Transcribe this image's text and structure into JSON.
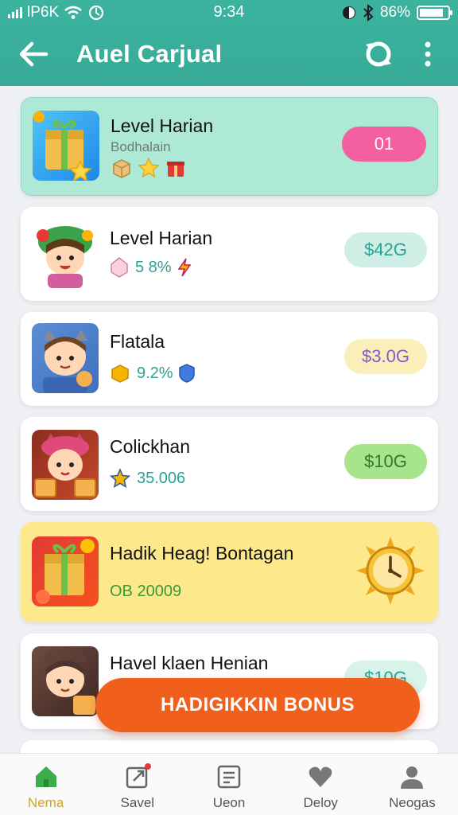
{
  "status_bar": {
    "carrier": "lP6K",
    "time": "9:34",
    "battery": "86%",
    "battery_level": 0.86
  },
  "app_bar": {
    "title": "Auel Carjual"
  },
  "cards": [
    {
      "title": "Level Harian",
      "subtitle": "Bodhalain",
      "pill": "01",
      "pill_bg": "#f45fa0",
      "pill_fg": "#ffffff"
    },
    {
      "title": "Level Harian",
      "value": "5 8%",
      "pill": "$42G",
      "pill_bg": "#cfeee6",
      "pill_fg": "#2aa394"
    },
    {
      "title": "Flatala",
      "value": "9.2%",
      "pill": "$3.0G",
      "pill_bg": "#fbefb9",
      "pill_fg": "#7a5bd6"
    },
    {
      "title": "Colickhan",
      "value": "35.006",
      "pill": "$10G",
      "pill_bg": "#a8e48c",
      "pill_fg": "#2f7a2a"
    },
    {
      "title": "Hadik Heag! Bontagan",
      "value": "OB 20009"
    },
    {
      "title": "Havel klaen Henian",
      "pill": "$10G",
      "pill_bg": "#d8f3ea",
      "pill_fg": "#2aa394"
    }
  ],
  "fab": {
    "label": "HADIGIKKIN BONUS"
  },
  "bottom_nav": [
    {
      "label": "Nema",
      "icon": "home-icon",
      "active": true
    },
    {
      "label": "Savel",
      "icon": "share-icon"
    },
    {
      "label": "Ueon",
      "icon": "list-icon"
    },
    {
      "label": "Deloy",
      "icon": "heart-icon"
    },
    {
      "label": "Neogas",
      "icon": "profile-icon"
    }
  ],
  "colors": {
    "header": "#3bb39f",
    "accent": "#f05f1c",
    "active_nav": "#d3a21f"
  }
}
